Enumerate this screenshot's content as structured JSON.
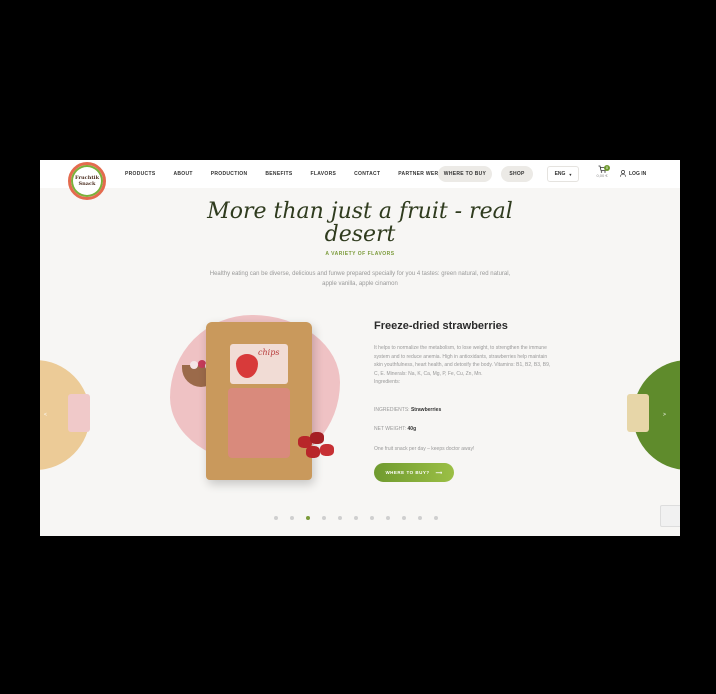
{
  "brand": {
    "logo_line1": "Fruchtik",
    "logo_line2": "Snack"
  },
  "nav": {
    "items": [
      "PRODUCTS",
      "ABOUT",
      "PRODUCTION",
      "BENEFITS",
      "FLAVORS",
      "CONTACT",
      "PARTNER WERDEN"
    ],
    "where_to_buy": "WHERE TO BUY",
    "shop": "SHOP",
    "language": "ENG",
    "cart_count": "0",
    "cart_amount": "0,00 €",
    "login": "LOG IN"
  },
  "hero": {
    "headline": "More than just a fruit - real desert",
    "subheadline": "A VARIETY OF FLAVORS",
    "intro": "Healthy eating can be diverse, delicious and funwe prepared specially for you 4 tastes: green natural, red natural, apple vanilla, apple cinamon"
  },
  "product": {
    "title": "Freeze-dried strawberries",
    "package_label": "chips",
    "description": "It helps to normalize the metabolism, to lose weight, to strengthen the immune system and to reduce anemia. High in antioxidants, strawberries help maintain skin youthfulness, heart health, and detoxify the body. Vitamins: B1, B2, B3, B9, C, E. Minerals: Na, K, Ca, Mg, P, Fe, Cu, Zn, Mn.",
    "ingredients_heading": "Ingredients:",
    "ingredients_label": "INGREDIENTS:",
    "ingredients_value": "Strawberries",
    "weight_label": "NET WEIGHT:",
    "weight_value": "40g",
    "tagline": "One fruit snack per day – keeps doctor away!",
    "cta": "WHERE TO BUY?",
    "cta_icon": "arrow-right-icon"
  },
  "carousel": {
    "dot_count": 11,
    "active_index": 2,
    "prev_label": "< ",
    "next_label": "> "
  },
  "colors": {
    "accent_green": "#7b9b3a",
    "blob_pink": "#efc2c4",
    "left_slide": "#eccb97",
    "right_slide": "#5f8b2c"
  }
}
